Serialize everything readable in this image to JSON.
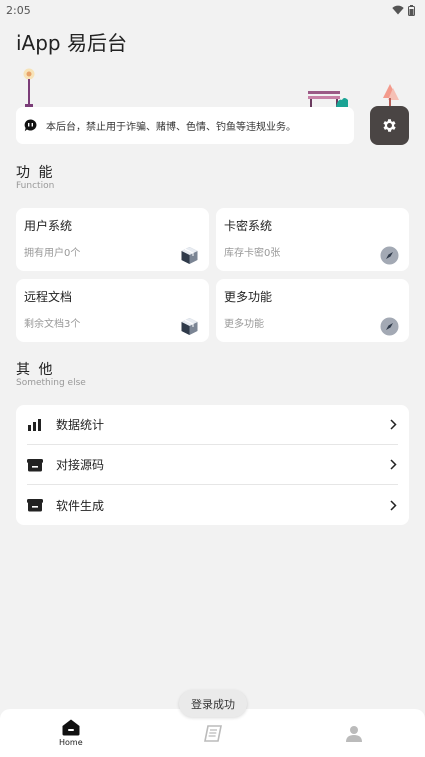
{
  "status_bar": {
    "time": "2:05",
    "wifi_icon": "wifi-icon",
    "battery_icon": "battery-icon"
  },
  "header": {
    "title": "iApp 易后台"
  },
  "notice": {
    "icon": "chat-icon",
    "text": "本后台，禁止用于诈骗、赌博、色情、钓鱼等违规业务。"
  },
  "settings": {
    "icon": "gear-icon",
    "bg_color": "#4a4544"
  },
  "function_section": {
    "title": "功 能",
    "subtitle": "Function",
    "cards": [
      {
        "title": "用户系统",
        "sub": "拥有用户0个",
        "icon": "cube-icon"
      },
      {
        "title": "卡密系统",
        "sub": "库存卡密0张",
        "icon": "compass-icon"
      },
      {
        "title": "远程文档",
        "sub": "剩余文档3个",
        "icon": "cube-icon"
      },
      {
        "title": "更多功能",
        "sub": "更多功能",
        "icon": "compass-icon"
      }
    ]
  },
  "other_section": {
    "title": "其 他",
    "subtitle": "Something else",
    "items": [
      {
        "label": "数据统计",
        "icon": "bar-chart-icon"
      },
      {
        "label": "对接源码",
        "icon": "inbox-icon"
      },
      {
        "label": "软件生成",
        "icon": "inbox-icon"
      }
    ]
  },
  "toast": {
    "text": "登录成功"
  },
  "bottom_nav": {
    "items": [
      {
        "label": "Home",
        "icon": "home-icon",
        "active": true
      },
      {
        "label": "",
        "icon": "book-icon",
        "active": false
      },
      {
        "label": "",
        "icon": "person-icon",
        "active": false
      }
    ]
  }
}
